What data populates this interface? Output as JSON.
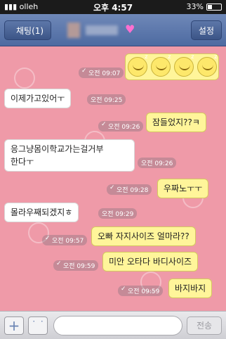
{
  "status": {
    "carrier": "olleh",
    "time": "오후 4:57",
    "battery": "33%"
  },
  "header": {
    "back_label": "채팅(1)",
    "settings_label": "설정"
  },
  "messages": [
    {
      "type": "out",
      "text": "",
      "time": "오전 09:07",
      "kind": "emoticons"
    },
    {
      "type": "in",
      "text": "이제가고있어ㅜ",
      "time": "오전 09:25"
    },
    {
      "type": "out",
      "text": "잠들었지??ㅋ",
      "time": "오전 09:26"
    },
    {
      "type": "in",
      "text": "응그냥몸이학교가는걸거부\n한다ㅜ",
      "time": "오전 09:26"
    },
    {
      "type": "out",
      "text": "우짜노ㅜㅜ",
      "time": "오전 09:28"
    },
    {
      "type": "in",
      "text": "몰라우째되겠지ㅎ",
      "time": "오전 09:29"
    },
    {
      "type": "out",
      "text": "오빠 자지사이즈 얼마라??",
      "time": "오전 09:57"
    },
    {
      "type": "out",
      "text": "미안 오타다 바디사이즈",
      "time": "오전 09:59"
    },
    {
      "type": "out",
      "text": "바지바지",
      "time": "오전 09:59"
    }
  ],
  "input": {
    "placeholder": "",
    "send_label": "전송"
  },
  "colors": {
    "chat_bg": "#ef9aa8",
    "out_bubble": "#fff59a",
    "in_bubble": "#ffffff",
    "header": "#4d6aa1"
  }
}
